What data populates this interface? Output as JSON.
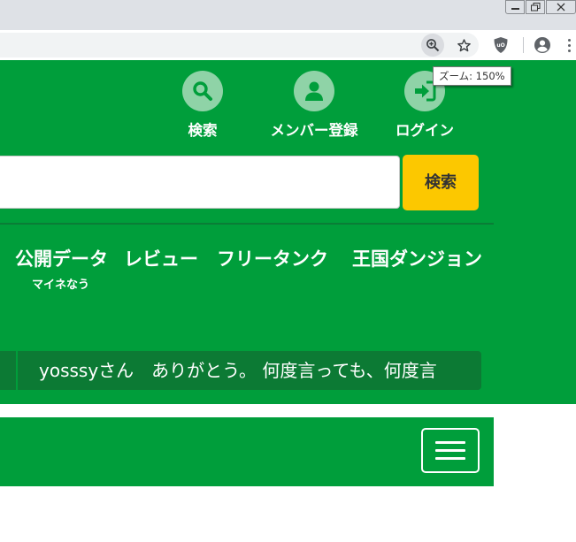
{
  "browser": {
    "zoom_tooltip": "ズーム: 150%",
    "icons": {
      "zoom": "zoom-in-icon",
      "bookmark": "star-icon",
      "extension": "ublock-shield-icon",
      "profile": "account-circle-icon",
      "menu": "more-vert-icon"
    }
  },
  "header": {
    "links": [
      {
        "label": "検索",
        "icon": "search-icon"
      },
      {
        "label": "メンバー登録",
        "icon": "person-icon"
      },
      {
        "label": "ログイン",
        "icon": "login-icon"
      }
    ]
  },
  "search": {
    "value": "",
    "button_label": "検索"
  },
  "nav": {
    "items": [
      {
        "label": "公開データ",
        "sub": "マイネなう"
      },
      {
        "label": "レビュー",
        "sub": ""
      },
      {
        "label": "フリータンク",
        "sub": ""
      },
      {
        "label": "王国ダンジョン",
        "sub": ""
      }
    ]
  },
  "ticker": {
    "text": "yosssyさん　ありがとう。 何度言っても、何度言"
  },
  "colors": {
    "brand_green": "#009e3b",
    "dark_green": "#0c7a34",
    "button_yellow": "#fcc800",
    "icon_circle": "#8fd3a7"
  }
}
